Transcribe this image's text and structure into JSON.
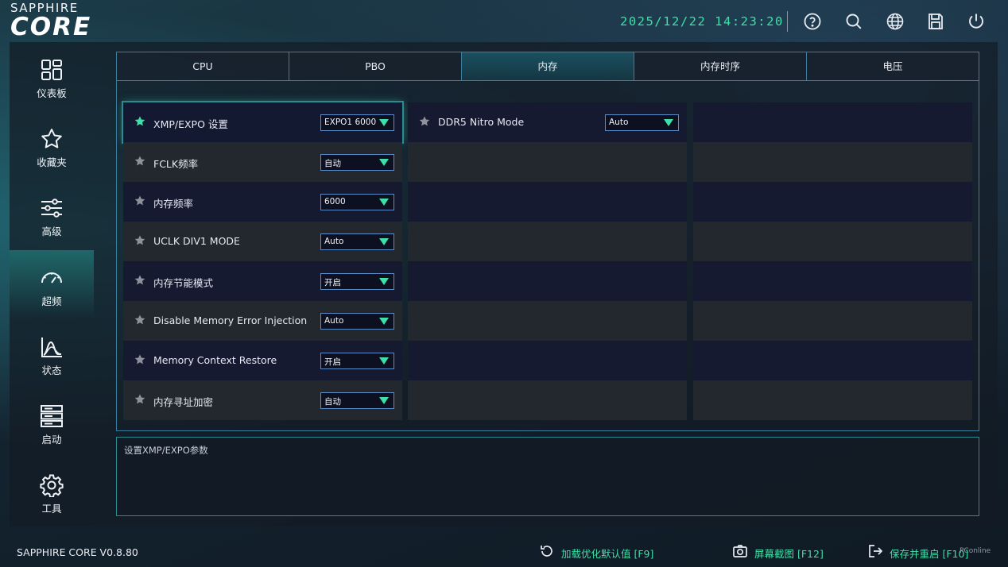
{
  "brand": {
    "small": "SAPPHIRE",
    "big": "CORE"
  },
  "header": {
    "datetime": "2025/12/22 14:23:20"
  },
  "sidebar": {
    "items": [
      {
        "label": "仪表板",
        "icon": "dashboard-icon"
      },
      {
        "label": "收藏夹",
        "icon": "star-icon"
      },
      {
        "label": "高级",
        "icon": "sliders-icon"
      },
      {
        "label": "超频",
        "icon": "speedometer-icon",
        "active": true
      },
      {
        "label": "状态",
        "icon": "status-chart-icon"
      },
      {
        "label": "启动",
        "icon": "boot-stack-icon"
      },
      {
        "label": "工具",
        "icon": "gear-icon"
      }
    ]
  },
  "tabs": [
    {
      "label": "CPU"
    },
    {
      "label": "PBO"
    },
    {
      "label": "内存",
      "active": true
    },
    {
      "label": "内存时序"
    },
    {
      "label": "电压"
    }
  ],
  "settings": {
    "col1": [
      {
        "label": "XMP/EXPO 设置",
        "value": "EXPO1 6000",
        "selected": true
      },
      {
        "label": "FCLK频率",
        "value": "自动"
      },
      {
        "label": "内存频率",
        "value": "6000"
      },
      {
        "label": "UCLK DIV1 MODE",
        "value": "Auto"
      },
      {
        "label": "内存节能模式",
        "value": "开启"
      },
      {
        "label": "Disable Memory Error Injection",
        "value": "Auto"
      },
      {
        "label": "Memory Context Restore",
        "value": "开启"
      },
      {
        "label": "内存寻址加密",
        "value": "自动"
      }
    ],
    "col2": [
      {
        "label": "DDR5 Nitro Mode",
        "value": "Auto"
      }
    ]
  },
  "description": "设置XMP/EXPO参数",
  "footer": {
    "version": "SAPPHIRE CORE V0.8.80",
    "load_defaults": "加载优化默认值 [F9]",
    "screenshot": "屏幕截图 [F12]",
    "save_restart": "保存并重启 [F10]",
    "watermark": "PConline"
  },
  "colors": {
    "accent": "#3ee0a8",
    "border": "#3b7ea0",
    "row_dark": "#151a30",
    "row_light": "#23282f"
  }
}
